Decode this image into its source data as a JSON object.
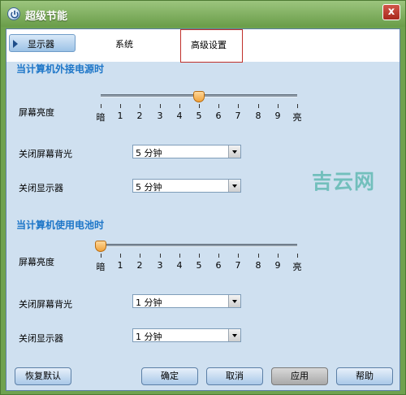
{
  "window": {
    "title": "超级节能",
    "close_label": "x"
  },
  "tabs": {
    "display": "显示器",
    "system": "系统",
    "advanced": "高级设置"
  },
  "ac_section": {
    "heading": "当计算机外接电源时",
    "brightness_label": "屏幕亮度",
    "brightness_level": 5,
    "backlight_label": "关闭屏幕背光",
    "backlight_value": "5 分钟",
    "display_label": "关闭显示器",
    "display_value": "5 分钟"
  },
  "battery_section": {
    "heading": "当计算机使用电池时",
    "brightness_label": "屏幕亮度",
    "brightness_level": 0,
    "backlight_label": "关闭屏幕背光",
    "backlight_value": "1 分钟",
    "display_label": "关闭显示器",
    "display_value": "1 分钟"
  },
  "slider_ticks": [
    "暗",
    "1",
    "2",
    "3",
    "4",
    "5",
    "6",
    "7",
    "8",
    "9",
    "亮"
  ],
  "watermark": "吉云网",
  "buttons": {
    "restore": "恢复默认",
    "ok": "确定",
    "cancel": "取消",
    "apply": "应用",
    "help": "帮助"
  }
}
